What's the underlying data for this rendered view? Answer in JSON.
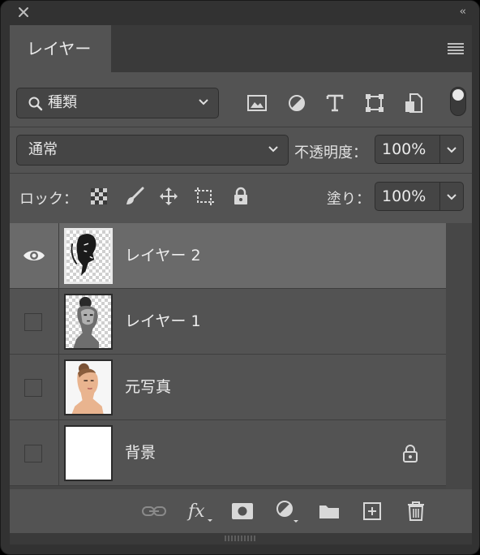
{
  "panel": {
    "tab_title": "レイヤー"
  },
  "filter": {
    "kind_label": "種類"
  },
  "blend": {
    "mode_label": "通常",
    "opacity_label": "不透明度：",
    "opacity_value": "100%"
  },
  "lock": {
    "label": "ロック：",
    "fill_label": "塗り：",
    "fill_value": "100%"
  },
  "layers": [
    {
      "name": "レイヤー 2",
      "selected": true,
      "visible": true
    },
    {
      "name": "レイヤー 1",
      "selected": false,
      "visible": false
    },
    {
      "name": "元写真",
      "selected": false,
      "visible": false
    },
    {
      "name": "背景",
      "selected": false,
      "visible": false,
      "locked": true
    }
  ],
  "colors": {
    "panel_bg": "#535353",
    "selected_row": "#6a6a6a"
  }
}
